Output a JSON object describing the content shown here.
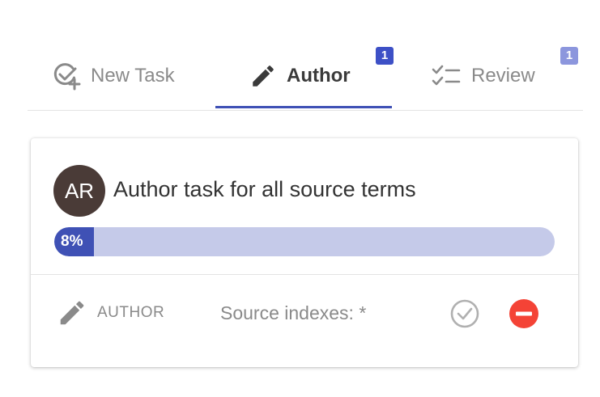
{
  "tabs": [
    {
      "label": "New Task",
      "icon": "task-add-icon"
    },
    {
      "label": "Author",
      "icon": "pencil-icon",
      "badge": "1"
    },
    {
      "label": "Review",
      "icon": "checklist-icon",
      "badge": "1"
    }
  ],
  "task": {
    "avatar_initials": "AR",
    "title": "Author task for all source terms",
    "progress_percent": 8,
    "progress_label": "8%",
    "role": "AUTHOR",
    "role_icon": "pencil-icon",
    "source_indexes": "Source indexes: *"
  },
  "colors": {
    "accent": "#3f51b5",
    "progress_track": "#c5cae9",
    "badge_primary": "#3d50c6",
    "badge_muted": "#8c96dd",
    "avatar_bg": "#4a3b37",
    "remove_red": "#f44336"
  }
}
